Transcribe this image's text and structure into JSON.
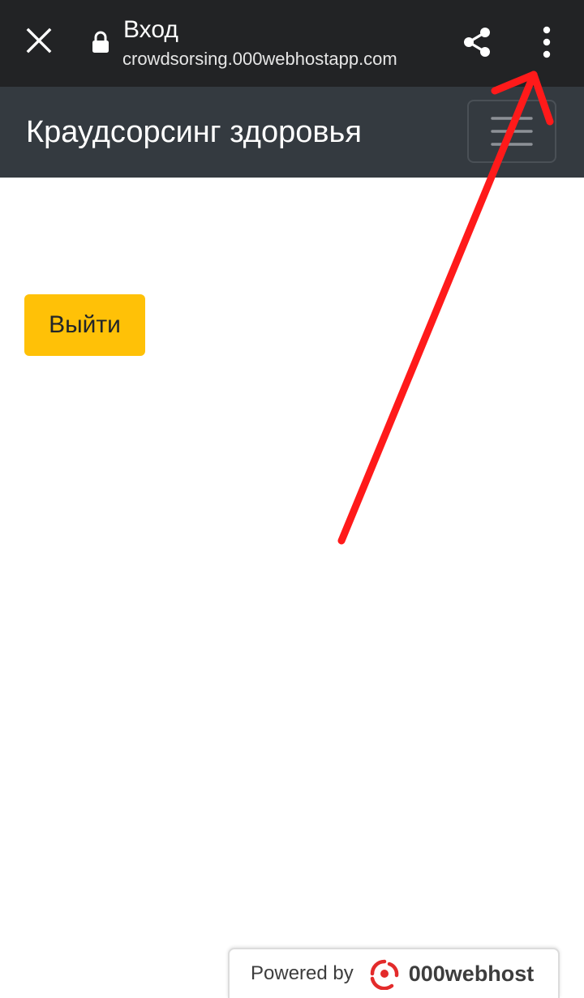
{
  "browser": {
    "title": "Вход",
    "url": "crowdsorsing.000webhostapp.com",
    "icons": {
      "close": "close-icon",
      "lock": "lock-icon",
      "share": "share-icon",
      "menu": "more-vert-icon"
    }
  },
  "navbar": {
    "brand": "Краудсорсинг здоровья",
    "toggler_icon": "hamburger-menu-icon"
  },
  "main": {
    "logout_label": "Выйти"
  },
  "footer": {
    "powered_label": "Powered by",
    "host_name": "000webhost"
  },
  "colors": {
    "browser_bar": "#222325",
    "navbar": "#343a40",
    "logout_button": "#ffc107",
    "annotation_arrow": "#ff1a1a",
    "host_logo": "#e32b2b"
  }
}
